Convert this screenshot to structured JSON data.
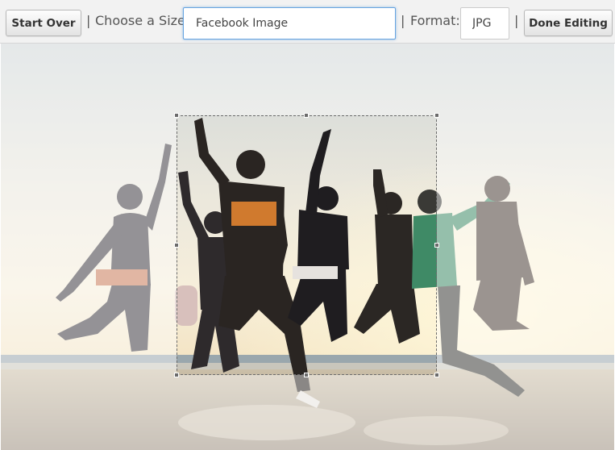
{
  "toolbar": {
    "start_over_label": "Start Over",
    "separator": "|",
    "choose_size_label": "Choose a Size:",
    "size_value": "Facebook Image",
    "format_label": "Format:",
    "format_value": "JPG",
    "done_label": "Done Editing"
  },
  "colors": {
    "toolbar_bg": "#f2f2f2",
    "input_focus_border": "#66a4e0",
    "crop_border": "#6b6b6b"
  },
  "icons": {
    "crop_handles": "square-handle"
  }
}
